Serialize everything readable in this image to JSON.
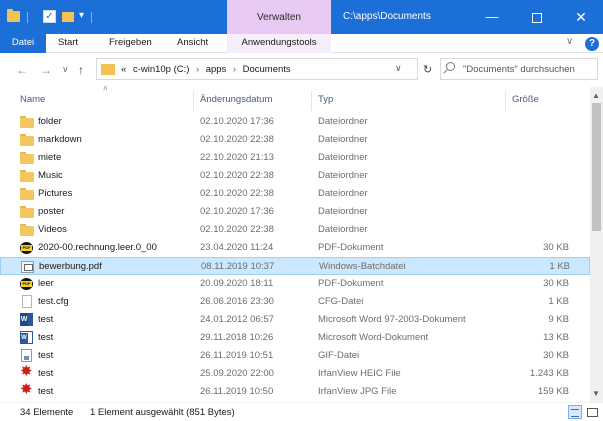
{
  "window": {
    "context_tab_label": "Verwalten",
    "path_title": "C:\\apps\\Documents",
    "min_glyph": "—",
    "close_glyph": "✕",
    "quick_access_arrow": "▾"
  },
  "ribbon": {
    "file_tab": "Datei",
    "tabs": [
      "Start",
      "Freigeben",
      "Ansicht",
      "Anwendungstools"
    ],
    "expand_glyph": "∨",
    "help_glyph": "?"
  },
  "nav": {
    "back_glyph": "←",
    "forward_glyph": "→",
    "recent_glyph": "∨",
    "up_glyph": "↑",
    "refresh_glyph": "↻"
  },
  "address": {
    "prefix": "«",
    "crumbs": [
      "c-win10p (C:)",
      "apps",
      "Documents"
    ],
    "separator": "›",
    "dropdown_glyph": "∨"
  },
  "search": {
    "placeholder": "\"Documents\" durchsuchen"
  },
  "columns": {
    "name": "Name",
    "date": "Änderungsdatum",
    "type": "Typ",
    "size": "Größe",
    "sort_glyph": "˄"
  },
  "files": [
    {
      "icon": "folder",
      "name": "folder",
      "date": "02.10.2020 17:36",
      "type": "Dateiordner",
      "size": ""
    },
    {
      "icon": "folder",
      "name": "markdown",
      "date": "02.10.2020 22:38",
      "type": "Dateiordner",
      "size": ""
    },
    {
      "icon": "folder",
      "name": "miete",
      "date": "22.10.2020 21:13",
      "type": "Dateiordner",
      "size": ""
    },
    {
      "icon": "folder",
      "name": "Music",
      "date": "02.10.2020 22:38",
      "type": "Dateiordner",
      "size": ""
    },
    {
      "icon": "folder",
      "name": "Pictures",
      "date": "02.10.2020 22:38",
      "type": "Dateiordner",
      "size": ""
    },
    {
      "icon": "folder",
      "name": "poster",
      "date": "02.10.2020 17:36",
      "type": "Dateiordner",
      "size": ""
    },
    {
      "icon": "folder",
      "name": "Videos",
      "date": "02.10.2020 22:38",
      "type": "Dateiordner",
      "size": ""
    },
    {
      "icon": "pdf",
      "name": "2020-00.rechnung.leer.0_00",
      "date": "23.04.2020 11:24",
      "type": "PDF-Dokument",
      "size": "30 KB"
    },
    {
      "icon": "bat",
      "name": "bewerbung.pdf",
      "date": "08.11.2019 10:37",
      "type": "Windows-Batchdatei",
      "size": "1 KB",
      "selected": true
    },
    {
      "icon": "pdf",
      "name": "leer",
      "date": "20.09.2020 18:11",
      "type": "PDF-Dokument",
      "size": "30 KB"
    },
    {
      "icon": "cfg",
      "name": "test.cfg",
      "date": "26.06.2016 23:30",
      "type": "CFG-Datei",
      "size": "1 KB"
    },
    {
      "icon": "word",
      "name": "test",
      "date": "24.01.2012 06:57",
      "type": "Microsoft Word 97-2003-Dokument",
      "size": "9 KB"
    },
    {
      "icon": "word2",
      "name": "test",
      "date": "29.11.2018 10:26",
      "type": "Microsoft Word-Dokument",
      "size": "13 KB"
    },
    {
      "icon": "gif",
      "name": "test",
      "date": "26.11.2019 10:51",
      "type": "GIF-Datei",
      "size": "30 KB"
    },
    {
      "icon": "irfan",
      "name": "test",
      "date": "25.09.2020 22:00",
      "type": "IrfanView HEIC File",
      "size": "1.243 KB"
    },
    {
      "icon": "irfan",
      "name": "test",
      "date": "26.11.2019 10:50",
      "type": "IrfanView JPG File",
      "size": "159 KB"
    }
  ],
  "scrollbar": {
    "up_glyph": "▲",
    "down_glyph": "▼"
  },
  "status": {
    "count": "34 Elemente",
    "selection": "1 Element ausgewählt (851 Bytes)"
  }
}
